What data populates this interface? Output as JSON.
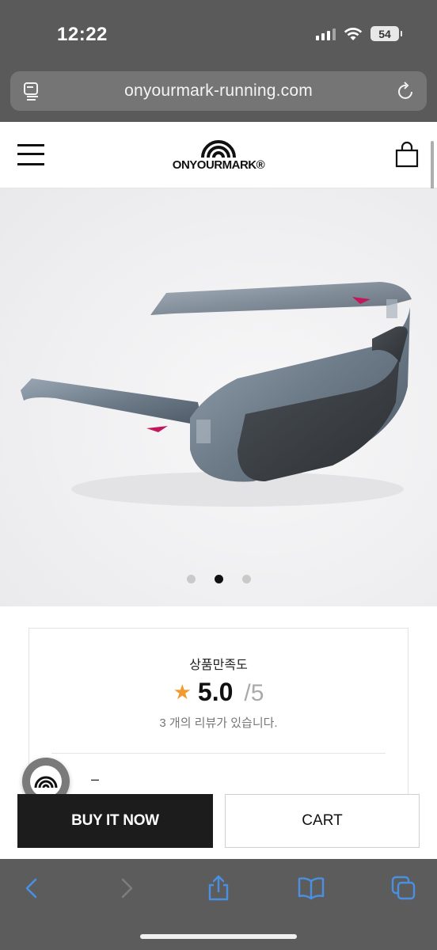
{
  "status_bar": {
    "time": "12:22",
    "battery": "54"
  },
  "browser": {
    "url": "onyourmark-running.com"
  },
  "site": {
    "logo_text": "ONYOURMARK®"
  },
  "carousel": {
    "slide_count": 3,
    "active_index": 1
  },
  "review": {
    "title": "상품만족도",
    "score": "5.0",
    "max": "/5",
    "count_text": "3 개의 리뷰가 있습니다.",
    "dash": "–"
  },
  "actions": {
    "buy_label": "BUY IT NOW",
    "cart_label": "CART"
  },
  "colors": {
    "status_bg": "#5a5a5a",
    "url_bar_bg": "#757575",
    "buy_bg": "#1c1c1c",
    "star": "#f29a2e",
    "toolbar_icon": "#4a90e2"
  }
}
